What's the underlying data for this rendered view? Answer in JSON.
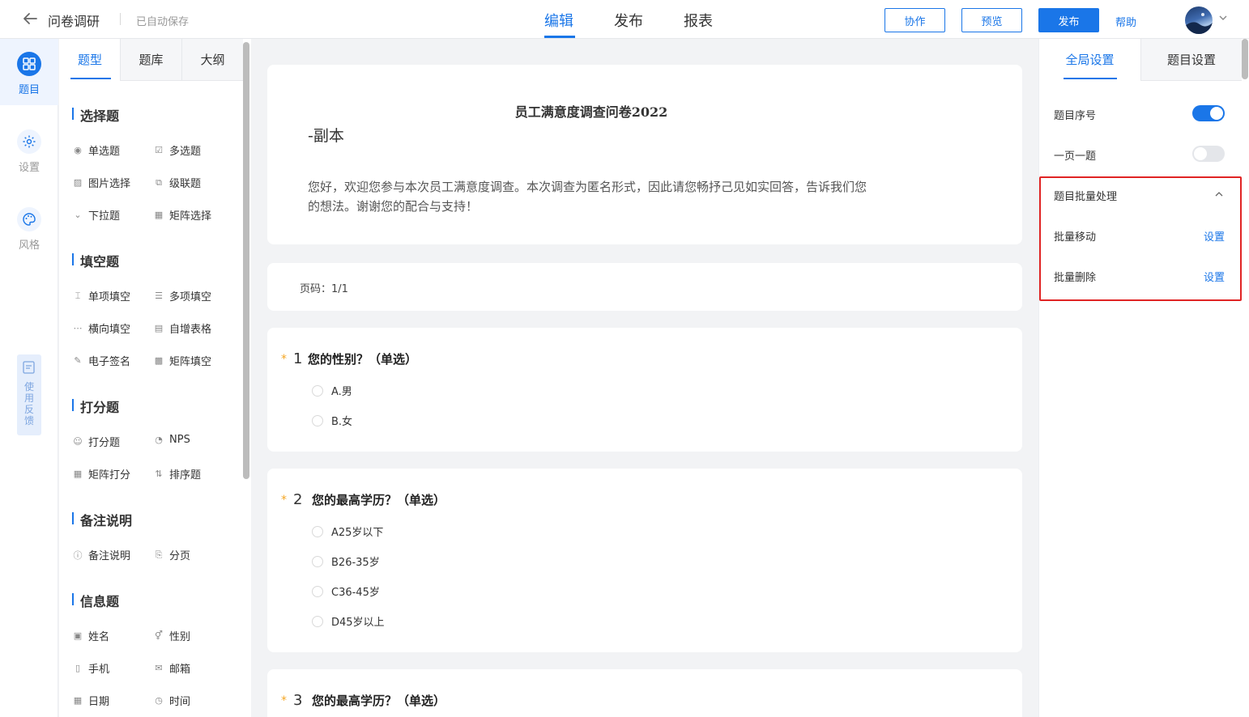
{
  "header": {
    "title": "问卷调研",
    "autosave": "已自动保存",
    "modes": [
      "编辑",
      "发布",
      "报表"
    ],
    "active_mode": "编辑",
    "collab": "协作",
    "preview": "预览",
    "publish": "发布",
    "help": "帮助"
  },
  "rail": {
    "items": [
      {
        "label": "题目",
        "icon": "grid-icon"
      },
      {
        "label": "设置",
        "icon": "gear-icon"
      },
      {
        "label": "风格",
        "icon": "palette-icon"
      }
    ],
    "feedback": "使用反馈"
  },
  "left_panel": {
    "tabs": [
      "题型",
      "题库",
      "大纲"
    ],
    "sections": [
      {
        "title": "选择题",
        "items": [
          "单选题",
          "多选题",
          "图片选择",
          "级联题",
          "下拉题",
          "矩阵选择"
        ]
      },
      {
        "title": "填空题",
        "items": [
          "单项填空",
          "多项填空",
          "横向填空",
          "自增表格",
          "电子签名",
          "矩阵填空"
        ]
      },
      {
        "title": "打分题",
        "items": [
          "打分题",
          "NPS",
          "矩阵打分",
          "排序题"
        ]
      },
      {
        "title": "备注说明",
        "items": [
          "备注说明",
          "分页"
        ]
      },
      {
        "title": "信息题",
        "items": [
          "姓名",
          "性别",
          "手机",
          "邮箱",
          "日期",
          "时间"
        ]
      }
    ]
  },
  "survey": {
    "title": "员工满意度调查问卷2022",
    "subtitle": "-副本",
    "description": "您好，欢迎您参与本次员工满意度调查。本次调查为匿名形式，因此请您畅抒己见如实回答，告诉我们您的想法。谢谢您的配合与支持！",
    "pager": "页码：1/1",
    "questions": [
      {
        "num": "1",
        "text": "您的性别？（单选）",
        "options": [
          "A.男",
          "B.女"
        ]
      },
      {
        "num": "2",
        "text": "您的最高学历？（单选）",
        "options": [
          "A25岁以下",
          "B26-35岁",
          "C36-45岁",
          "D45岁以上"
        ]
      },
      {
        "num": "3",
        "text": "您的最高学历？（单选）",
        "options": []
      }
    ]
  },
  "right_panel": {
    "tabs": [
      "全局设置",
      "题目设置"
    ],
    "show_numbers": {
      "label": "题目序号",
      "on": true
    },
    "one_per_page": {
      "label": "一页一题",
      "on": false
    },
    "batch": {
      "title": "题目批量处理",
      "move": "批量移动",
      "delete": "批量删除",
      "set": "设置"
    }
  }
}
